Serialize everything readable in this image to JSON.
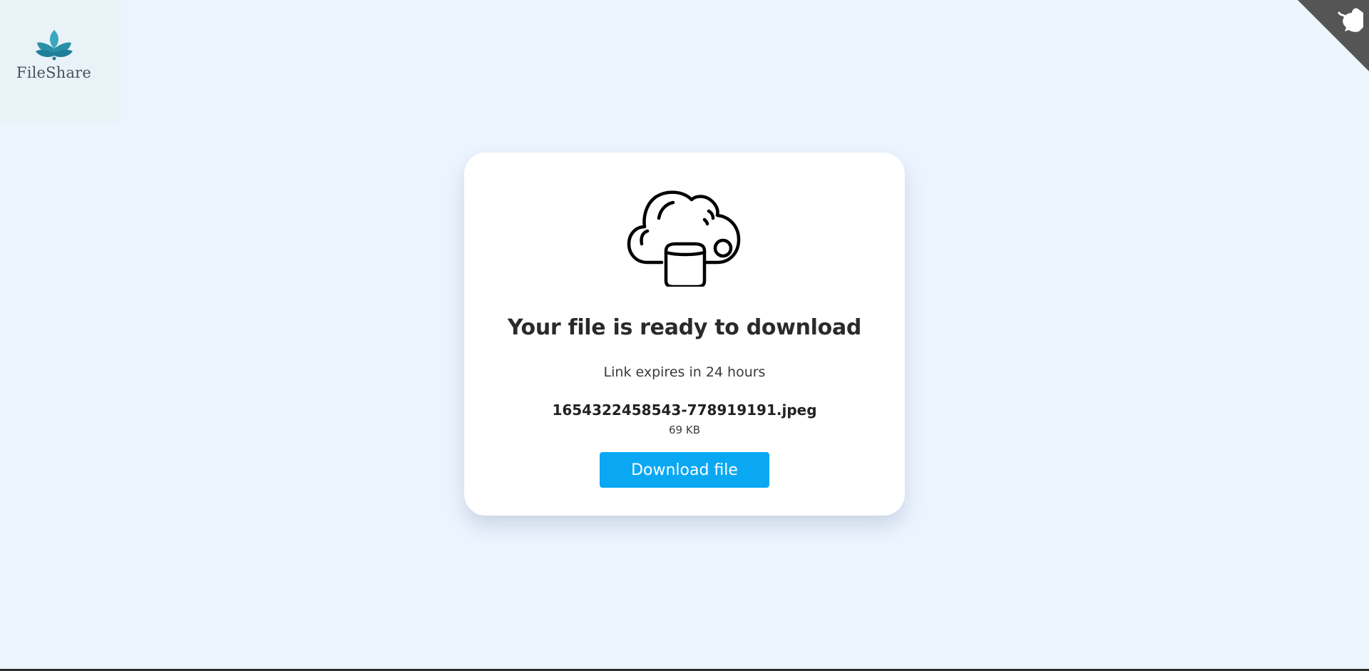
{
  "brand": {
    "name": "FileShare",
    "logo_icon": "lotus-icon",
    "logo_color": "#2a9db5"
  },
  "corner": {
    "icon": "github-icon",
    "background": "#555555"
  },
  "card": {
    "illustration": "cloud-storage-icon",
    "title": "Your file is ready to download",
    "expiry": "Link expires in 24 hours",
    "file": {
      "name": "1654322458543-778919191.jpeg",
      "size": "69 KB"
    },
    "download_label": "Download file",
    "accent_color": "#0aa8f3"
  }
}
